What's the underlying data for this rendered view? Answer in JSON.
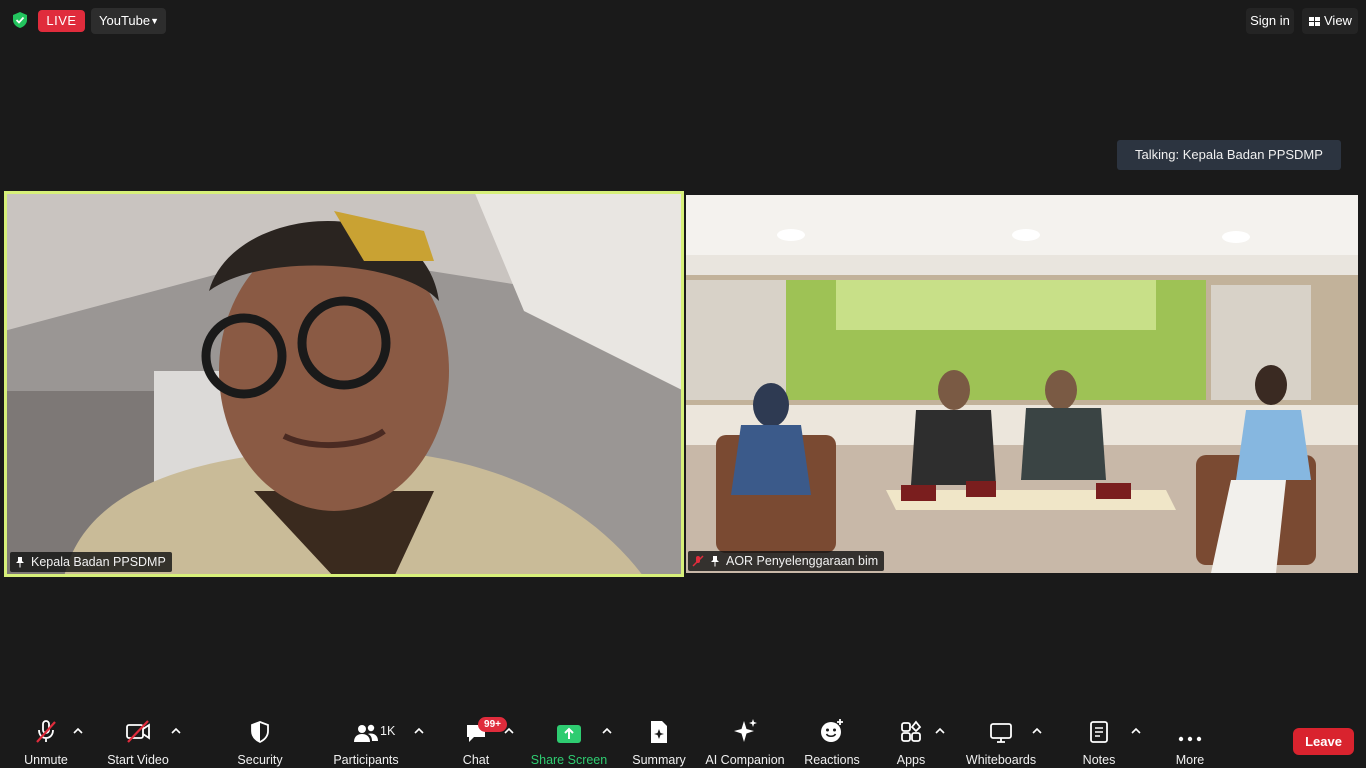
{
  "top_bar": {
    "live_label": "LIVE",
    "stream_target": "YouTube",
    "sign_in_label": "Sign in",
    "view_label": "View"
  },
  "talking_indicator": "Talking: Kepala Badan PPSDMP",
  "tiles": [
    {
      "name": "Kepala Badan PPSDMP",
      "pinned": true,
      "active_speaker": true
    },
    {
      "name": "AOR Penyelenggaraan bim",
      "pinned": true,
      "muted": true
    }
  ],
  "toolbar": {
    "unmute": "Unmute",
    "start_video": "Start Video",
    "security": "Security",
    "participants": "Participants",
    "participants_count": "1K",
    "chat": "Chat",
    "chat_badge": "99+",
    "share_screen": "Share Screen",
    "summary": "Summary",
    "ai_companion": "AI Companion",
    "reactions": "Reactions",
    "apps": "Apps",
    "whiteboards": "Whiteboards",
    "notes": "Notes",
    "more": "More",
    "leave": "Leave"
  },
  "colors": {
    "background": "#1a1a1a",
    "live_red": "#e02c3c",
    "active_speaker_border": "#d7f07a",
    "share_green": "#2ecc71",
    "leave_red": "#d9232e"
  }
}
